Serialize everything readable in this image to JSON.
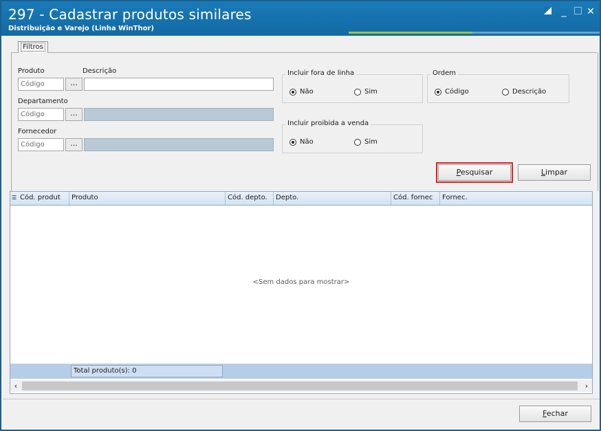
{
  "window": {
    "title": "297 - Cadastrar produtos similares",
    "subtitle": "Distribuição e Varejo (Linha WinThor)",
    "controls": {
      "minimize": "_",
      "close": "✕"
    }
  },
  "tabs": [
    {
      "label": "Filtros",
      "active": true
    }
  ],
  "filters": {
    "produto_label": "Produto",
    "descricao_label": "Descrição",
    "produto_placeholder": "Código",
    "descricao_value": "",
    "departamento_label": "Departamento",
    "departamento_placeholder": "Código",
    "fornecedor_label": "Fornecedor",
    "fornecedor_placeholder": "Código",
    "ellipsis": "..."
  },
  "groups": {
    "fora_de_linha": {
      "title": "Incluir fora de linha",
      "options": [
        "Não",
        "Sim"
      ],
      "selected": "Não"
    },
    "ordem": {
      "title": "Ordem",
      "options": [
        "Código",
        "Descrição"
      ],
      "selected": "Código"
    },
    "proibida_venda": {
      "title": "Incluir proibida a venda",
      "options": [
        "Não",
        "Sim"
      ],
      "selected": "Não"
    }
  },
  "buttons": {
    "pesquisar": {
      "first": "P",
      "rest": "esquisar"
    },
    "limpar": {
      "first": "L",
      "rest": "impar"
    },
    "fechar": {
      "first": "F",
      "rest": "echar"
    }
  },
  "grid": {
    "columns": [
      "Cód. produt",
      "Produto",
      "Cód. depto.",
      "Depto.",
      "Cód. fornec",
      "Fornec."
    ],
    "empty_text": "<Sem dados para mostrar>",
    "footer_total": "Total produto(s): 0"
  },
  "colors": {
    "titlebar": "#1570ab",
    "highlight": "#d8232a",
    "grid_header": "#d3e3f3",
    "disabled_input": "#b9c9d6"
  }
}
